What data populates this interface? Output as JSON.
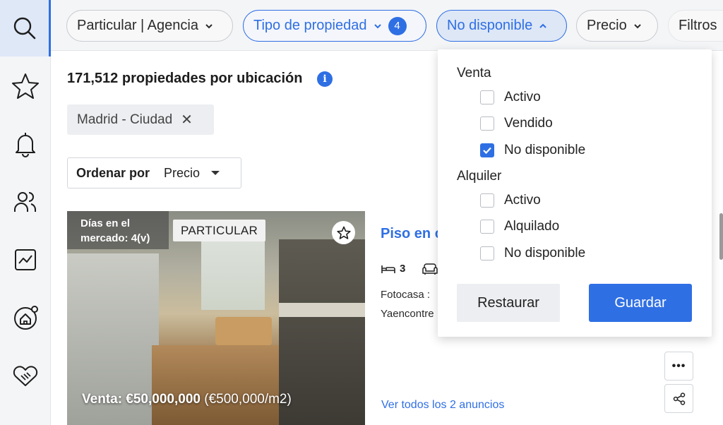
{
  "filters": {
    "seller": "Particular | Agencia",
    "property_type": "Tipo de propiedad",
    "property_type_count": "4",
    "status": "No disponible",
    "price": "Precio",
    "more": "Filtros"
  },
  "results": {
    "count_text": "171,512 propiedades por ubicación",
    "info": "i"
  },
  "location_chip": {
    "label": "Madrid - Ciudad",
    "remove": "✕"
  },
  "sort": {
    "label": "Ordenar por",
    "value": "Precio"
  },
  "listing": {
    "days_line1": "Días en el",
    "days_line2": "mercado: 4(v)",
    "owner_badge": "PARTICULAR",
    "price_bold": "Venta: €50,000,000",
    "price_per_m2": "(€500,000/m2)",
    "title": "Piso en c",
    "beds": "3",
    "source_line1": "Fotocasa :",
    "source_line2": "Yaencontre",
    "see_all": "Ver todos los 2 anuncios",
    "more_actions": "•••"
  },
  "status_panel": {
    "sale_group": "Venta",
    "sale_options": [
      {
        "label": "Activo",
        "checked": false
      },
      {
        "label": "Vendido",
        "checked": false
      },
      {
        "label": "No disponible",
        "checked": true
      }
    ],
    "rent_group": "Alquiler",
    "rent_options": [
      {
        "label": "Activo",
        "checked": false
      },
      {
        "label": "Alquilado",
        "checked": false
      },
      {
        "label": "No disponible",
        "checked": false
      }
    ],
    "reset_label": "Restaurar",
    "save_label": "Guardar"
  },
  "colors": {
    "accent": "#2f6fe4",
    "rail_active_bg": "#dfe8f7"
  },
  "icons": [
    "search-icon",
    "star-icon",
    "bell-icon",
    "users-icon",
    "chart-icon",
    "home-target-icon",
    "handshake-icon",
    "bed-icon",
    "sofa-icon",
    "share-icon",
    "star-outline-icon",
    "chevron-down-icon",
    "chevron-up-icon"
  ]
}
